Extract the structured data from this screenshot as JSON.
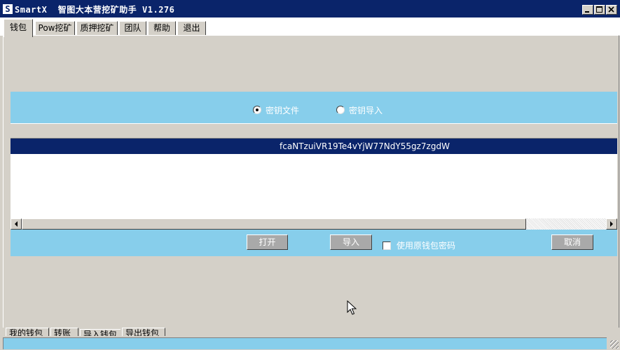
{
  "window": {
    "logo": "S",
    "title": "SmartX  智图大本营挖矿助手 V1.276"
  },
  "tabs": [
    {
      "label": "钱包",
      "active": true
    },
    {
      "label": "Pow挖矿",
      "active": false
    },
    {
      "label": "质押挖矿",
      "active": false
    },
    {
      "label": "团队",
      "active": false
    },
    {
      "label": "帮助",
      "active": false
    },
    {
      "label": "退出",
      "active": false
    }
  ],
  "import_mode": {
    "options": [
      {
        "label": "密钥文件",
        "selected": true
      },
      {
        "label": "密钥导入",
        "selected": false
      }
    ]
  },
  "key_list": {
    "rows": [
      {
        "value": "fcaNTzuiVR19Te4vYjW77NdY55gz7zgdW",
        "selected": true
      }
    ]
  },
  "actions": {
    "open_label": "打开",
    "import_label": "导入",
    "use_original_password_label": "使用原钱包密码",
    "use_original_password_checked": false,
    "cancel_label": "取消"
  },
  "bottom_tabs": [
    {
      "label": "我的钱包"
    },
    {
      "label": "转账"
    },
    {
      "label": "导入钱包"
    },
    {
      "label": "导出钱包"
    }
  ],
  "colors": {
    "titlebar": "#0a246a",
    "band": "#87ceeb",
    "selection": "#0a246a",
    "button_face": "#a9a9a9",
    "window_face": "#d4d0c8"
  },
  "icons": {
    "minimize": "minimize-icon",
    "maximize": "maximize-icon",
    "close": "close-icon",
    "scroll_left": "arrow-left-icon",
    "scroll_right": "arrow-right-icon",
    "resize": "resize-grip-icon",
    "pointer": "mouse-pointer-icon"
  }
}
